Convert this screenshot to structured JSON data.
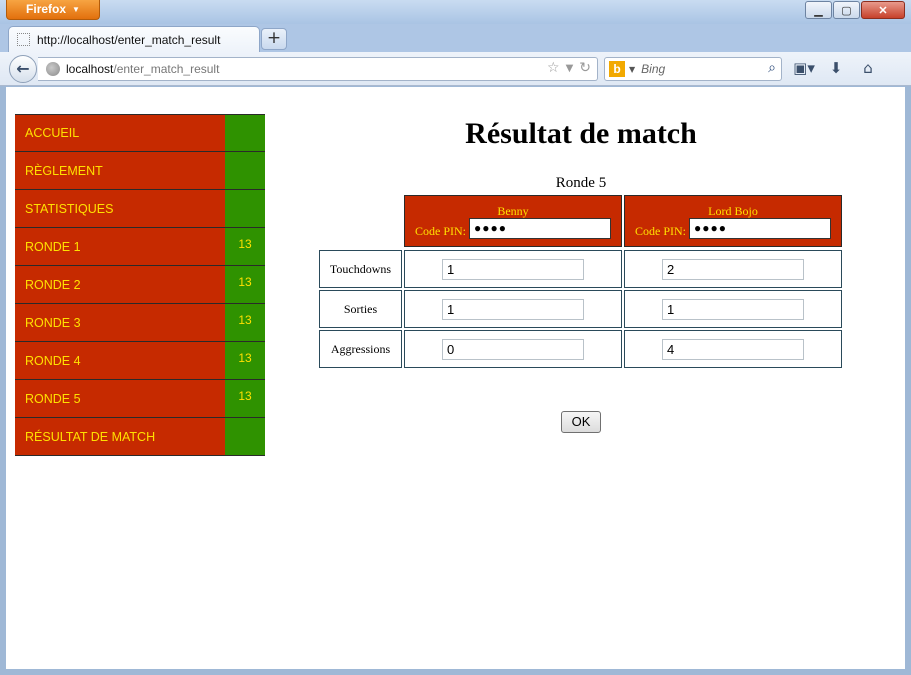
{
  "browser": {
    "menu_button_label": "Firefox",
    "tab_title": "http://localhost/enter_match_result",
    "url_host": "localhost",
    "url_path": "/enter_match_result",
    "search_placeholder": "Bing",
    "icons": [
      "back-icon",
      "globe-icon",
      "bookmark-star-icon",
      "dropdown-icon",
      "reload-icon",
      "bing-icon",
      "search-icon",
      "bookmarks-icon",
      "download-icon",
      "home-icon"
    ]
  },
  "sidebar": {
    "items": [
      {
        "label": "ACCUEIL",
        "count": ""
      },
      {
        "label": "RÈGLEMENT",
        "count": ""
      },
      {
        "label": "STATISTIQUES",
        "count": ""
      },
      {
        "label": "RONDE 1",
        "count": "13"
      },
      {
        "label": "RONDE 2",
        "count": "13"
      },
      {
        "label": "RONDE 3",
        "count": "13"
      },
      {
        "label": "RONDE 4",
        "count": "13"
      },
      {
        "label": "RONDE 5",
        "count": "13"
      },
      {
        "label": "RÉSULTAT DE MATCH",
        "count": ""
      }
    ]
  },
  "main": {
    "title": "Résultat de match",
    "round": "Ronde 5",
    "pin_label": "Code PIN:",
    "players": [
      {
        "name": "Benny",
        "pin_masked": "●●●●"
      },
      {
        "name": "Lord Bojo",
        "pin_masked": "●●●●"
      }
    ],
    "rows": [
      {
        "label": "Touchdowns",
        "values": [
          "1",
          "2"
        ]
      },
      {
        "label": "Sorties",
        "values": [
          "1",
          "1"
        ]
      },
      {
        "label": "Aggressions",
        "values": [
          "0",
          "4"
        ]
      }
    ],
    "submit_label": "OK"
  },
  "colors": {
    "menu_red": "#c62a00",
    "menu_green": "#2f9200",
    "menu_text": "#ffe000"
  }
}
